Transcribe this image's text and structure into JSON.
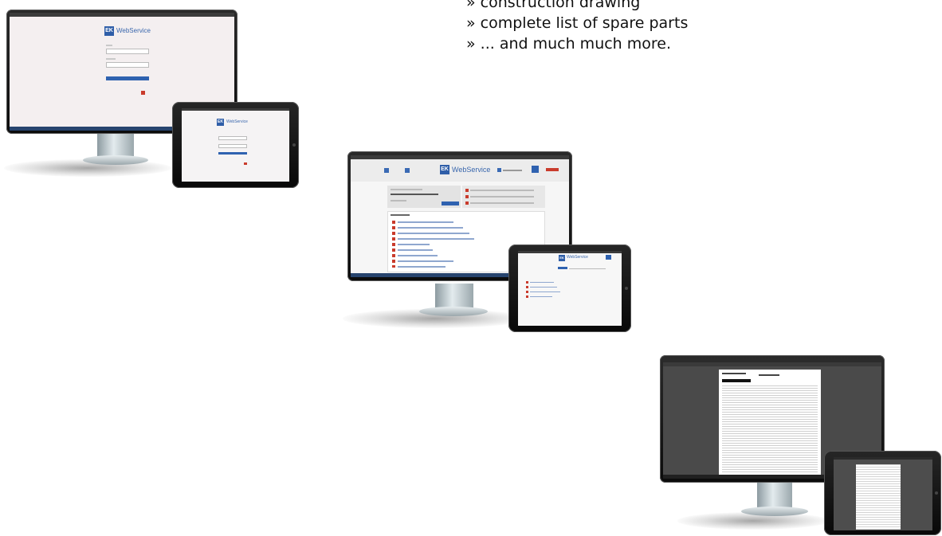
{
  "bullets": [
    "» construction drawing",
    "» complete list of spare parts",
    "» ... and much much more."
  ],
  "login_screen": {
    "brand_badge": "EK",
    "brand_name": "WebService"
  },
  "dashboard_screen": {
    "brand_badge": "EK",
    "brand_name": "WebService"
  },
  "colors": {
    "brand_blue": "#2f5ea8",
    "pdf_icon_red": "#c93b2c",
    "viewer_dark": "#4a4a4a"
  }
}
